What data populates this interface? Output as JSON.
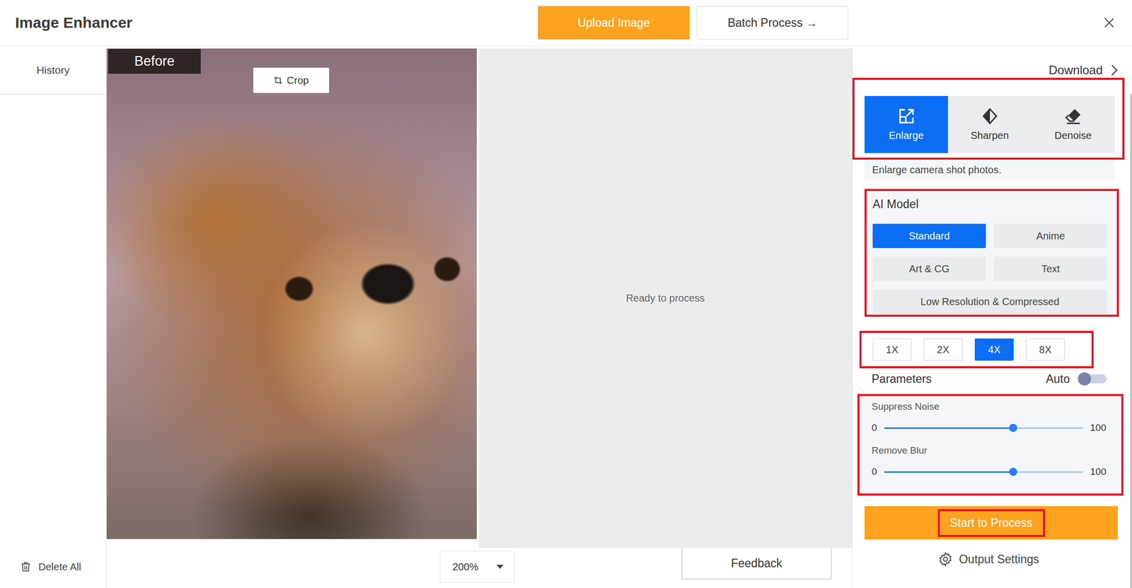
{
  "window": {
    "title": "Image Enhancer"
  },
  "header": {
    "upload": "Upload Image",
    "batch": "Batch Process →"
  },
  "sidebar": {
    "history": "History",
    "delete_all": "Delete All"
  },
  "preview": {
    "before": "Before",
    "crop": "Crop",
    "status": "Ready to process",
    "zoom": "200%",
    "feedback": "Feedback"
  },
  "panel": {
    "download": "Download",
    "modes": [
      {
        "label": "Enlarge",
        "selected": true
      },
      {
        "label": "Sharpen",
        "selected": false
      },
      {
        "label": "Denoise",
        "selected": false
      }
    ],
    "description": "Enlarge camera shot photos.",
    "ai_model": {
      "title": "AI Model",
      "options": [
        {
          "label": "Standard",
          "selected": true,
          "kind": "half"
        },
        {
          "label": "Anime",
          "selected": false,
          "kind": "half"
        },
        {
          "label": "Art & CG",
          "selected": false,
          "kind": "half"
        },
        {
          "label": "Text",
          "selected": false,
          "kind": "half"
        },
        {
          "label": "Low Resolution & Compressed",
          "selected": false,
          "kind": "wide"
        }
      ]
    },
    "scales": [
      {
        "label": "1X",
        "selected": false
      },
      {
        "label": "2X",
        "selected": false
      },
      {
        "label": "4X",
        "selected": true
      },
      {
        "label": "8X",
        "selected": false
      }
    ],
    "parameters": {
      "title": "Parameters",
      "auto_label": "Auto",
      "auto": false
    },
    "sliders": [
      {
        "label": "Suppress Noise",
        "min": "0",
        "max": "100",
        "level": 0.65
      },
      {
        "label": "Remove Blur",
        "min": "0",
        "max": "100",
        "level": 0.65
      }
    ],
    "start": "Start to Process",
    "output_settings": "Output Settings"
  }
}
